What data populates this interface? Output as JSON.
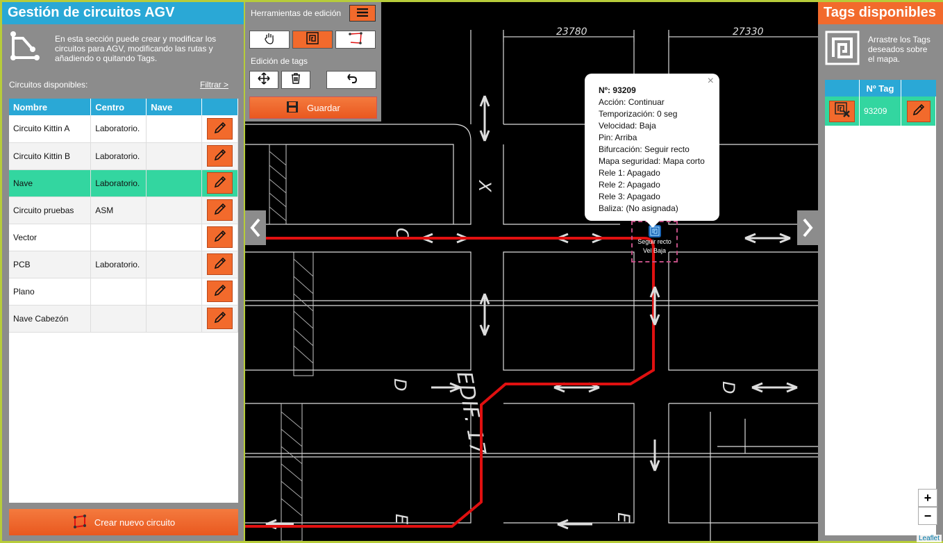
{
  "left_panel": {
    "title": "Gestión de circuitos AGV",
    "intro": "En esta sección puede crear y modificar los circuitos para AGV, modificando las rutas y añadiendo o quitando Tags.",
    "section_label": "Circuitos disponibles:",
    "filter_link": "Filtrar >",
    "columns": [
      "Nombre",
      "Centro",
      "Nave"
    ],
    "rows": [
      {
        "nombre": "Circuito Kittin A",
        "centro": "Laboratorio.",
        "nave": ""
      },
      {
        "nombre": "Circuito Kittin B",
        "centro": "Laboratorio.",
        "nave": ""
      },
      {
        "nombre": "Nave",
        "centro": "Laboratorio.",
        "nave": "",
        "selected": true
      },
      {
        "nombre": "Circuito pruebas",
        "centro": "ASM",
        "nave": ""
      },
      {
        "nombre": "Vector",
        "centro": "",
        "nave": ""
      },
      {
        "nombre": "PCB",
        "centro": "Laboratorio.",
        "nave": ""
      },
      {
        "nombre": "Plano",
        "centro": "",
        "nave": ""
      },
      {
        "nombre": "Nave Cabezón",
        "centro": "",
        "nave": ""
      }
    ],
    "create_button": "Crear nuevo circuito"
  },
  "toolbar": {
    "title": "Herramientas de edición",
    "tags_label": "Edición de tags",
    "save_button": "Guardar"
  },
  "map": {
    "dimensions": [
      "23780",
      "27330"
    ],
    "cad_labels": [
      "X",
      "C",
      "D",
      "E",
      "EDIF. 17"
    ]
  },
  "popup": {
    "lines": [
      {
        "label": "Nº:",
        "value": "93209",
        "bold": true
      },
      {
        "label": "Acción:",
        "value": "Continuar"
      },
      {
        "label": "Temporización:",
        "value": "0 seg"
      },
      {
        "label": "Velocidad:",
        "value": "Baja"
      },
      {
        "label": "Pin:",
        "value": "Arriba"
      },
      {
        "label": "Bifurcación:",
        "value": "Seguir recto"
      },
      {
        "label": "Mapa seguridad:",
        "value": "Mapa corto"
      },
      {
        "label": "Rele 1:",
        "value": "Apagado"
      },
      {
        "label": "Rele 2:",
        "value": "Apagado"
      },
      {
        "label": "Rele 3:",
        "value": "Apagado"
      },
      {
        "label": "Baliza:",
        "value": "(No asignada)"
      }
    ],
    "close": "×"
  },
  "tag_marker": {
    "line1": "Seguir recto",
    "line2": "Vel Baja"
  },
  "right_panel": {
    "title": "Tags disponibles",
    "intro": "Arrastre los Tags deseados sobre el mapa.",
    "column": "Nº Tag",
    "tags": [
      {
        "numero": "93209"
      }
    ]
  },
  "zoom": {
    "in": "+",
    "out": "−"
  },
  "attribution": "Leaflet",
  "colors": {
    "blue": "#2aa8d6",
    "orange": "#f26a2c",
    "green": "#33d6a0",
    "route": "#e01010",
    "gray": "#8c8c8c"
  }
}
